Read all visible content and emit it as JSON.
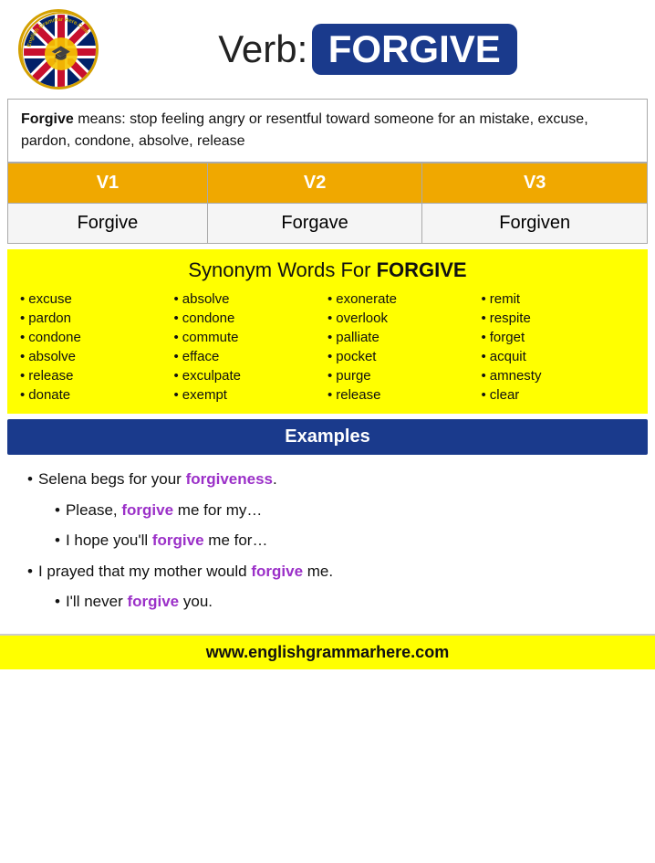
{
  "header": {
    "verb_label": "Verb:",
    "verb_word": "FORGIVE",
    "logo_alt": "English Grammar Here logo"
  },
  "definition": {
    "bold_word": "Forgive",
    "text": " means: stop feeling angry or resentful toward someone for an mistake, excuse, pardon, condone, absolve, release"
  },
  "table": {
    "headers": [
      "V1",
      "V2",
      "V3"
    ],
    "row": [
      "Forgive",
      "Forgave",
      "Forgiven"
    ]
  },
  "synonyms": {
    "title": "Synonym Words For ",
    "title_bold": "FORGIVE",
    "columns": [
      [
        "excuse",
        "pardon",
        "condone",
        "absolve",
        "release",
        "donate"
      ],
      [
        "absolve",
        "condone",
        "commute",
        "efface",
        "exculpate",
        "exempt"
      ],
      [
        "exonerate",
        "overlook",
        "palliate",
        "pocket",
        "purge",
        "release"
      ],
      [
        "remit",
        "respite",
        "forget",
        "acquit",
        "amnesty",
        "clear"
      ]
    ]
  },
  "examples": {
    "header": "Examples",
    "items": [
      {
        "text_before": "Selena begs for your ",
        "highlight": "forgiveness",
        "text_after": ".",
        "indent": false
      },
      {
        "text_before": "Please, ",
        "highlight": "forgive",
        "text_after": " me for my…",
        "indent": true
      },
      {
        "text_before": "I hope you'll ",
        "highlight": "forgive",
        "text_after": " me for…",
        "indent": true
      },
      {
        "text_before": "I prayed that my mother would ",
        "highlight": "forgive",
        "text_after": " me.",
        "indent": false
      },
      {
        "text_before": "I'll never ",
        "highlight": "forgive",
        "text_after": " you.",
        "indent": true
      }
    ]
  },
  "footer": {
    "url": "www.englishgrammarhere.com"
  }
}
